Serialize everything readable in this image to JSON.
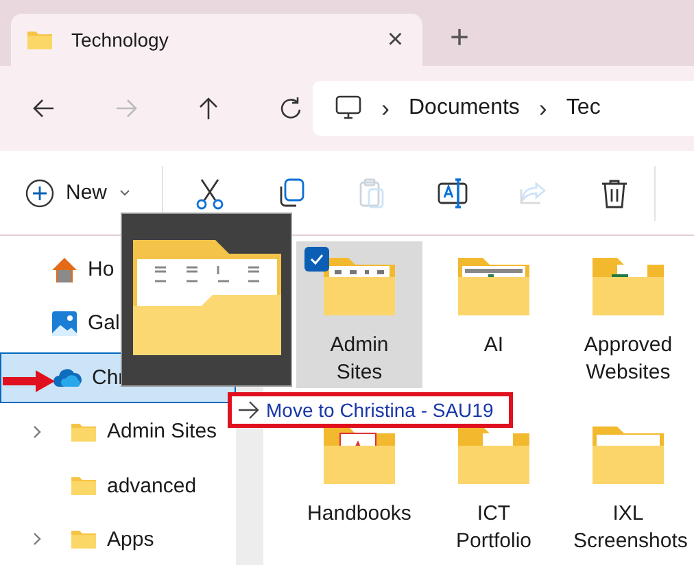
{
  "tabs": [
    {
      "title": "Technology",
      "selected": true
    }
  ],
  "tab_close": "×",
  "new_tab": "+",
  "nav": [
    {
      "kind": "back",
      "disabled": false
    },
    {
      "kind": "forward",
      "disabled": true
    },
    {
      "kind": "up",
      "disabled": false
    },
    {
      "kind": "refresh",
      "disabled": false
    }
  ],
  "address": {
    "separator": "›",
    "segments": [
      "Documents",
      "Tec"
    ]
  },
  "toolbar": {
    "new_label": "New",
    "tools": [
      {
        "kind": "cut",
        "disabled": false
      },
      {
        "kind": "copy",
        "disabled": false
      },
      {
        "kind": "paste",
        "disabled": true
      },
      {
        "kind": "rename",
        "disabled": false
      },
      {
        "kind": "share",
        "disabled": true
      },
      {
        "kind": "delete",
        "disabled": false
      }
    ]
  },
  "sidebar": {
    "items": [
      {
        "label": "Ho",
        "kind": "home",
        "selected": false
      },
      {
        "label": "Gal",
        "kind": "gallery",
        "selected": false
      },
      {
        "label": "Chr",
        "kind": "cloud",
        "selected": true,
        "children": [
          {
            "label": "Admin Sites",
            "expandable": true
          },
          {
            "label": "advanced",
            "expandable": false
          },
          {
            "label": "Apps",
            "expandable": true
          }
        ]
      }
    ]
  },
  "files": [
    {
      "name": "Admin Sites",
      "kind": "icons",
      "selected": true
    },
    {
      "name": "AI",
      "kind": "diagram",
      "selected": false
    },
    {
      "name": "Approved Websites",
      "kind": "excel",
      "selected": false
    },
    {
      "name": "Handbooks",
      "kind": "pdf",
      "selected": false
    },
    {
      "name": "ICT Portfolio",
      "kind": "word",
      "selected": false
    },
    {
      "name": "IXL Screenshots",
      "kind": "chart",
      "selected": false
    }
  ],
  "drag": {
    "tooltip": "Move to Christina - SAU19"
  }
}
